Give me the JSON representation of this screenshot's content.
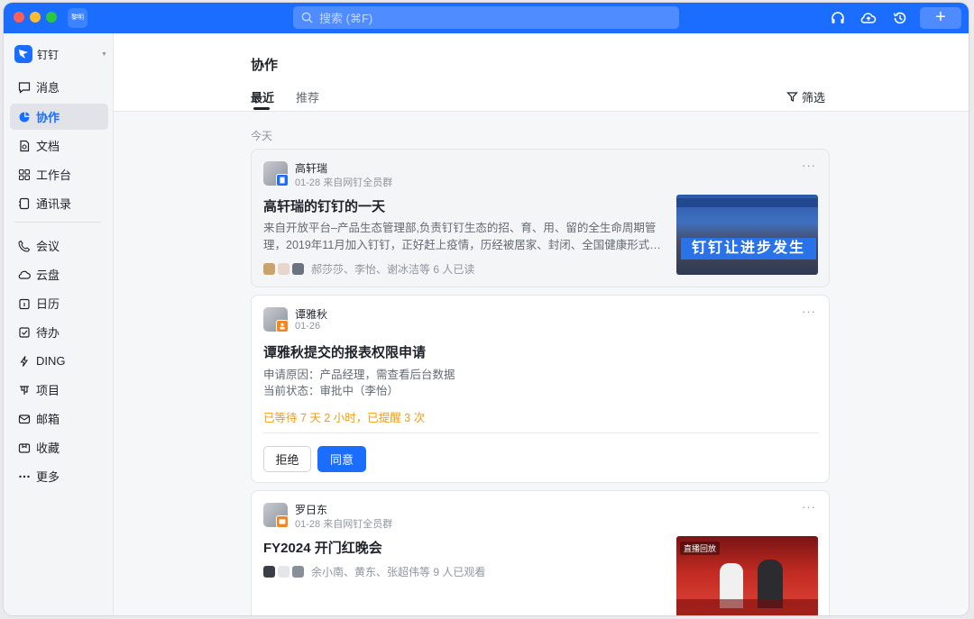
{
  "titlebar": {
    "mini_label": "黎明",
    "search_placeholder": "搜索 (⌘F)",
    "add_label": "+"
  },
  "sidebar": {
    "brand": "钉钉",
    "items": [
      {
        "label": "消息"
      },
      {
        "label": "协作"
      },
      {
        "label": "文档"
      },
      {
        "label": "工作台"
      },
      {
        "label": "通讯录"
      },
      {
        "label": "会议"
      },
      {
        "label": "云盘"
      },
      {
        "label": "日历"
      },
      {
        "label": "待办"
      },
      {
        "label": "DING"
      },
      {
        "label": "项目"
      },
      {
        "label": "邮箱"
      },
      {
        "label": "收藏"
      },
      {
        "label": "更多"
      }
    ]
  },
  "main": {
    "title": "协作",
    "tabs": [
      "最近",
      "推荐"
    ],
    "filter_label": "筛选",
    "section": "今天",
    "cards": [
      {
        "name": "高轩瑞",
        "meta": "01-28 来自网钉全员群",
        "title": "高轩瑞的钉钉的一天",
        "desc_line1": "来自开放平台–产品生态管理部,负责钉钉生态的招、育、用、留的全生命周期管",
        "desc_line2": "理，2019年11月加入钉钉，正好赶上疫情，历经被居家、封闭、全国健康形式…",
        "readers": "郝莎莎、李怡、谢冰洁等 6 人已读",
        "thumb_banner": "钉钉让进步发生"
      },
      {
        "name": "谭雅秋",
        "meta": "01-26",
        "title": "谭雅秋提交的报表权限申请",
        "desc_line1": "申请原因：产品经理，需查看后台数据",
        "desc_line2": "当前状态：审批中（李怡）",
        "warning": "已等待 7 天 2 小时，已提醒 3 次",
        "reject_label": "拒绝",
        "approve_label": "同意"
      },
      {
        "name": "罗日东",
        "meta": "01-28 来自网钉全员群",
        "title": "FY2024 开门红晚会",
        "readers": "余小南、黄东、张超伟等 9 人已观看",
        "thumb_tag": "直播回放"
      }
    ]
  },
  "colors": {
    "accent": "#1a6dff",
    "warning": "#f59a0d"
  }
}
